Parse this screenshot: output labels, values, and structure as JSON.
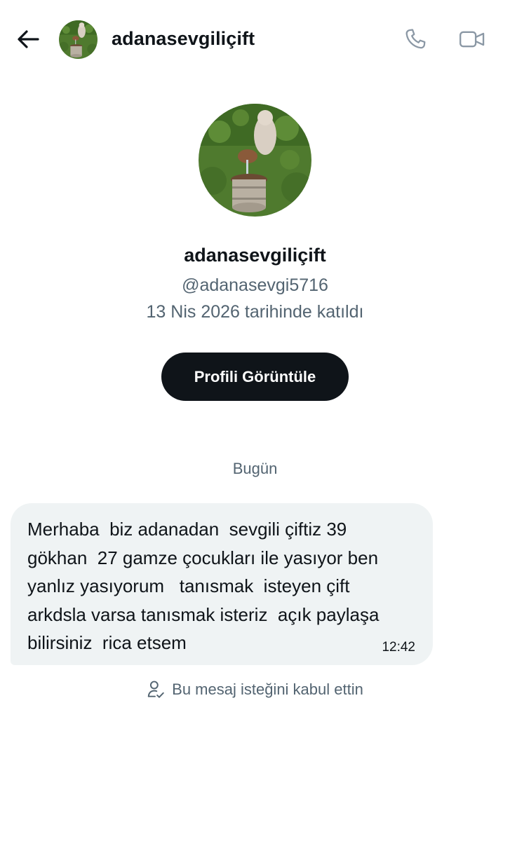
{
  "header": {
    "back_icon": "arrow-left-icon",
    "title": "adanasevgiliçift",
    "call_icon": "phone-icon",
    "video_icon": "video-camera-icon"
  },
  "profile": {
    "name": "adanasevgiliçift",
    "handle": "@adanasevgi5716",
    "joined": "13 Nis 2026 tarihinde katıldı",
    "view_profile_label": "Profili Görüntüle"
  },
  "conversation": {
    "date_separator": "Bugün",
    "messages": [
      {
        "text": "Merhaba  biz adanadan  sevgili çiftiz 39\ngökhan  27 gamze çocukları ile yasıyor ben\nyanlız yasıyorum   tanısmak  isteyen çift\narkdsla varsa tanısmak isteriz  açık paylaşa\nbilirsiniz  rica etsem",
        "time": "12:42"
      }
    ],
    "accepted_note": "Bu mesaj isteğini kabul ettin",
    "accepted_icon": "person-check-icon"
  },
  "colors": {
    "text_primary": "#0f1419",
    "text_secondary": "#536471",
    "bubble_bg": "#eff3f4",
    "button_bg": "#0f1419",
    "icon_gray": "#8b98a5"
  }
}
